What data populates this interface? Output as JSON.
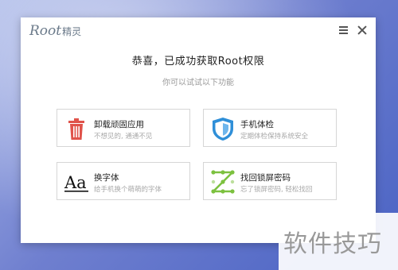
{
  "app": {
    "logo_text": "Root",
    "logo_cn": "精灵"
  },
  "window_buttons": {
    "menu_icon": "hamburger-icon",
    "close_icon": "close-icon"
  },
  "main": {
    "headline": "恭喜，已成功获取Root权限",
    "subline": "你可以试试以下功能"
  },
  "features": [
    {
      "title": "卸载顽固应用",
      "desc": "不想见的, 通通不见",
      "icon": "trash-icon",
      "color": "#e0534b"
    },
    {
      "title": "手机体检",
      "desc": "定期体检保持系统安全",
      "icon": "shield-icon",
      "color": "#2f8fd8"
    },
    {
      "title": "换字体",
      "desc": "给手机换个萌萌的字体",
      "icon": "font-aa-icon",
      "color": "#111111"
    },
    {
      "title": "找回锁屏密码",
      "desc": "忘了锁屏密码, 轻松找回",
      "icon": "pattern-lock-icon",
      "color": "#7cc13f"
    }
  ],
  "watermark": {
    "text": "软件技巧"
  }
}
